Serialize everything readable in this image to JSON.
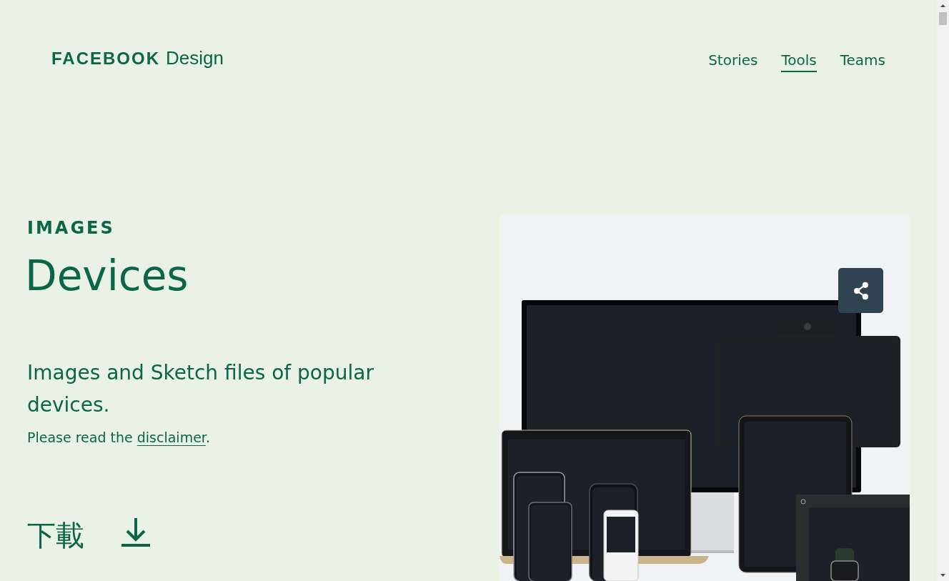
{
  "brand": {
    "name": "FACEBOOK",
    "suffix": "Design"
  },
  "nav": [
    {
      "label": "Stories",
      "selected": false
    },
    {
      "label": "Tools",
      "selected": true
    },
    {
      "label": "Teams",
      "selected": false
    }
  ],
  "eyebrow": "IMAGES",
  "title": "Devices",
  "description": "Images and Sketch files of popular devices.",
  "disclaimer": {
    "before": "Please read the ",
    "link": "disclaimer",
    "after": "."
  },
  "download": {
    "label": "下載"
  }
}
